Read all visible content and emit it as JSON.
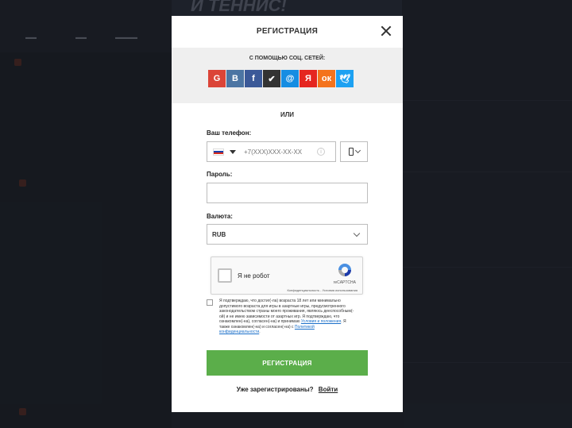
{
  "background": {
    "banner": "И ТЕННИС!"
  },
  "modal": {
    "title": "РЕГИСТРАЦИЯ",
    "social_label": "С ПОМОЩЬЮ СОЦ. СЕТЕЙ:",
    "social": [
      {
        "icon": "google-icon",
        "glyph": "G",
        "color": "#db4437"
      },
      {
        "icon": "vk-icon",
        "glyph": "B",
        "color": "#4c75a3"
      },
      {
        "icon": "facebook-icon",
        "glyph": "f",
        "color": "#3b5998"
      },
      {
        "icon": "steam-icon",
        "glyph": "✔",
        "color": "#333333"
      },
      {
        "icon": "mailru-icon",
        "glyph": "@",
        "color": "#168de2"
      },
      {
        "icon": "yandex-icon",
        "glyph": "Я",
        "color": "#e52620"
      },
      {
        "icon": "odnoklassniki-icon",
        "glyph": "ок",
        "color": "#f4731c"
      },
      {
        "icon": "twitter-icon",
        "glyph": "🕊",
        "color": "#1da1f2"
      }
    ],
    "or_label": "ИЛИ",
    "phone": {
      "label": "Ваш телефон:",
      "placeholder": "+7(XXX)XXX-XX-XX"
    },
    "password": {
      "label": "Пароль:"
    },
    "currency": {
      "label": "Валюта:",
      "value": "RUB"
    },
    "captcha": {
      "text": "Я не робот",
      "brand": "reCAPTCHA",
      "links": "Конфиденциальность - Условия использования"
    },
    "agreement": {
      "text": "Я подтверждаю, что достиг(-ла) возраста 18 лет или минимально допустимого возраста для игры в азартные игры, предусмотренного законодательством страны моего проживания, являюсь дееспособным(-ой) и не имею зависимости от азартных игр. Я подтверждаю, что ознакомлен(-на), согласен(-на) и принимаю",
      "link1": "Условия и положения",
      "middle": ". Я также ознакомлен(-на) и согласен(-на) с",
      "link2": "Политикой конфиденциальности",
      "end": "."
    },
    "submit_label": "РЕГИСТРАЦИЯ",
    "login_prompt": "Уже зарегистрированы?",
    "login_link": "Войти"
  },
  "colors": {
    "accent_green": "#5bae4a",
    "link_blue": "#1a6fc9"
  }
}
